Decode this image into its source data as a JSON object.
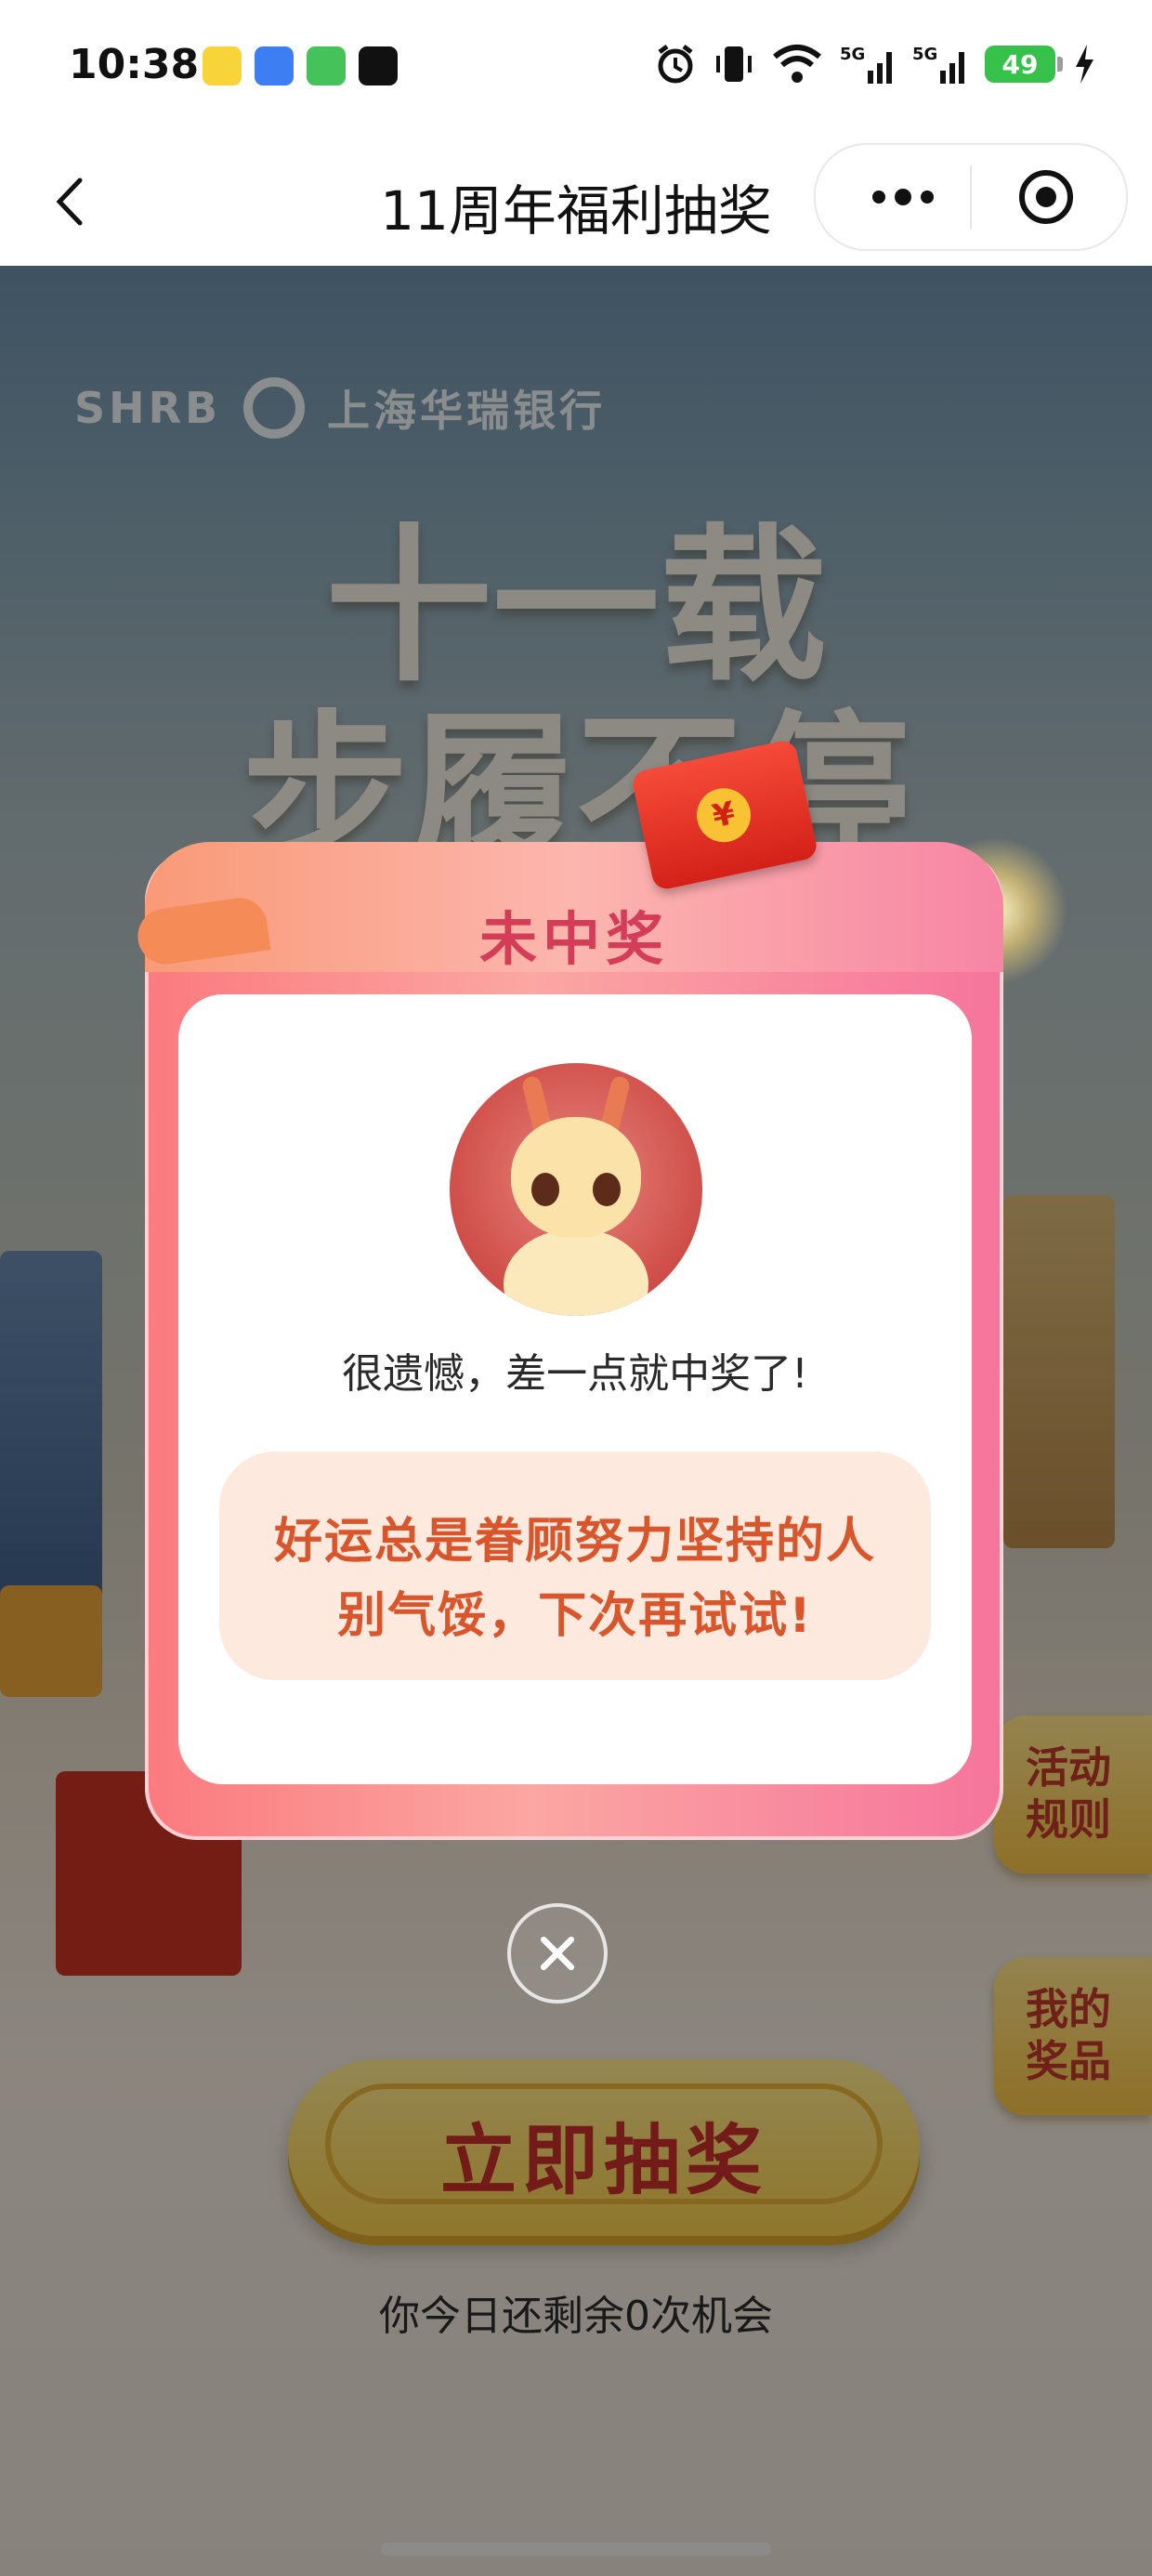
{
  "status_bar": {
    "time": "10:38",
    "battery": "49",
    "network_labels": [
      "5G",
      "5G"
    ]
  },
  "nav": {
    "title": "11周年福利抽奖"
  },
  "background": {
    "brand_text": "SHRB",
    "bank_name": "上海华瑞银行",
    "slogan_line1": "十一载",
    "slogan_line2": "步履不停"
  },
  "side_buttons": {
    "rules": "活动规则",
    "prizes": "我的奖品"
  },
  "draw_button": {
    "label": "立即抽奖"
  },
  "chances_text": "你今日还剩余0次机会",
  "dialog": {
    "title": "未中奖",
    "message": "很遗憾，差一点就中奖了!",
    "tip_line1": "好运总是眷顾努力坚持的人",
    "tip_line2": "别气馁，下次再试试!",
    "red_packet_symbol": "¥"
  },
  "colors": {
    "accent_red": "#d43d58",
    "tip_orange": "#d9562c",
    "battery_green": "#35c14a"
  }
}
